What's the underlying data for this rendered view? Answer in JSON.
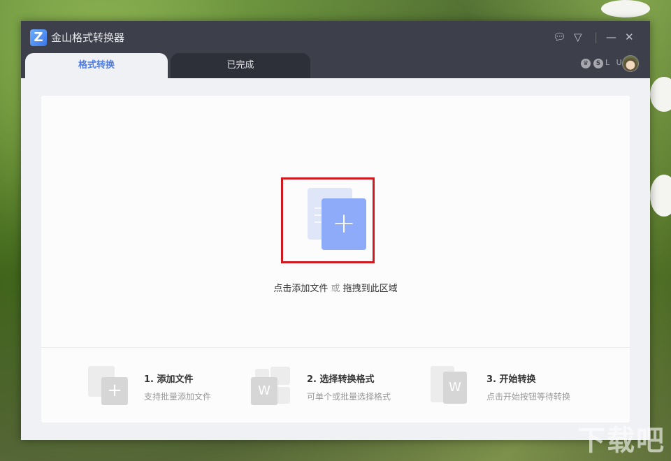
{
  "app": {
    "title": "金山格式转换器",
    "logo": "Z"
  },
  "tabs": [
    {
      "label": "格式转换",
      "active": true
    },
    {
      "label": "已完成",
      "active": false
    }
  ],
  "user": {
    "badge_crown": "crown-icon",
    "badge_s": "S",
    "levels": "L U"
  },
  "drop": {
    "plus": "+",
    "hint_add": "点击添加文件",
    "hint_or": "或",
    "hint_drag": "拖拽到此区域"
  },
  "steps": [
    {
      "title": "1. 添加文件",
      "desc": "支持批量添加文件"
    },
    {
      "title": "2. 选择转换格式",
      "desc": "可单个或批量选择格式"
    },
    {
      "title": "3. 开始转换",
      "desc": "点击开始按钮等待转换"
    }
  ],
  "watermark": "下载吧",
  "colors": {
    "accent": "#4c7de8",
    "titlebar": "#3d404b",
    "highlight": "#d0191f"
  }
}
